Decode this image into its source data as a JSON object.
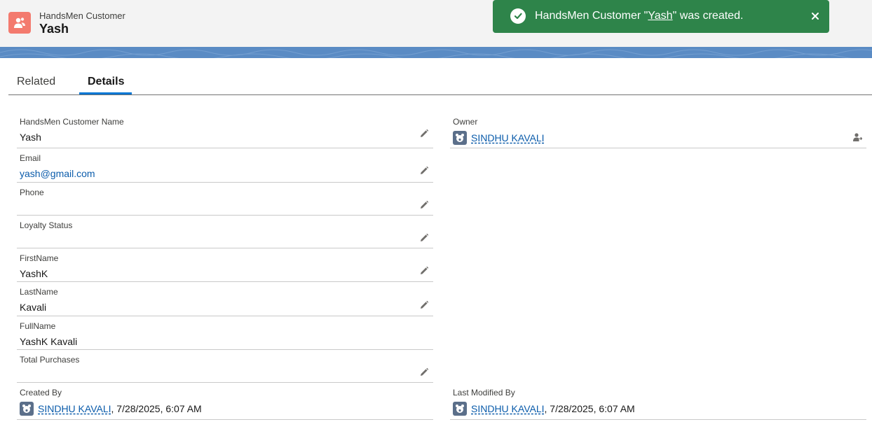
{
  "header": {
    "object_type": "HandsMen Customer",
    "record_name": "Yash"
  },
  "toast": {
    "prefix": "HandsMen Customer \"",
    "record_link": "Yash",
    "suffix": "\" was created."
  },
  "tabs": [
    {
      "label": "Related",
      "active": false
    },
    {
      "label": "Details",
      "active": true
    }
  ],
  "left_fields": [
    {
      "label": "HandsMen Customer Name",
      "value": "Yash",
      "editable": true
    },
    {
      "label": "Email",
      "value": "yash@gmail.com",
      "editable": true,
      "link": true
    },
    {
      "label": "Phone",
      "value": "",
      "editable": true
    },
    {
      "label": "Loyalty Status",
      "value": "",
      "editable": true
    },
    {
      "label": "FirstName",
      "value": "YashK",
      "editable": true
    },
    {
      "label": "LastName",
      "value": "Kavali",
      "editable": true
    },
    {
      "label": "FullName",
      "value": "YashK Kavali",
      "editable": false
    },
    {
      "label": "Total Purchases",
      "value": "",
      "editable": true
    }
  ],
  "owner": {
    "label": "Owner",
    "name": "SINDHU KAVALI"
  },
  "created_by": {
    "label": "Created By",
    "name": "SINDHU KAVALI",
    "datetime": ", 7/28/2025, 6:07 AM"
  },
  "last_modified_by": {
    "label": "Last Modified By",
    "name": "SINDHU KAVALI",
    "datetime": ", 7/28/2025, 6:07 AM"
  },
  "colors": {
    "toast_success": "#2e844a",
    "object_icon": "#f37a6e",
    "link": "#0b5cab",
    "tab_active": "#0176d3"
  }
}
